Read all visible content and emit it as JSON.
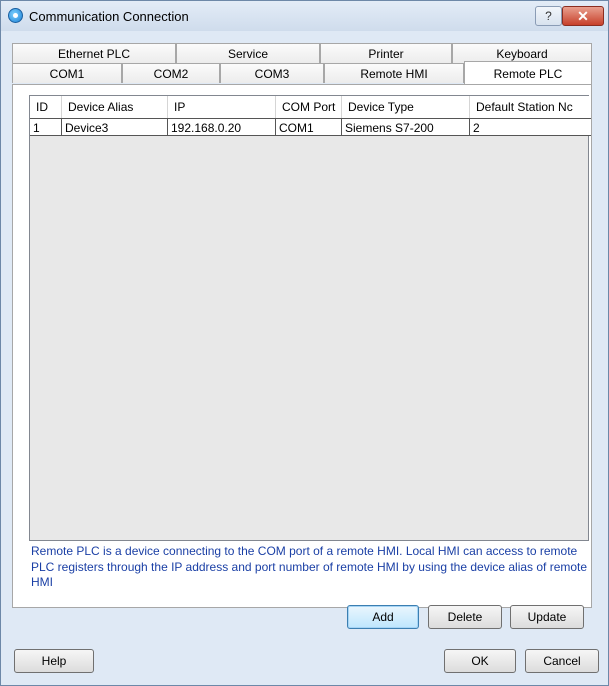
{
  "window": {
    "title": "Communication Connection",
    "help_glyph": "?",
    "close_glyph": "✕"
  },
  "tabs_top": [
    "Ethernet PLC",
    "Service",
    "Printer",
    "Keyboard"
  ],
  "tabs_bottom": [
    "COM1",
    "COM2",
    "COM3",
    "Remote HMI",
    "Remote PLC"
  ],
  "active_tab": "Remote PLC",
  "table": {
    "columns": [
      "ID",
      "Device Alias",
      "IP",
      "COM Port",
      "Device Type",
      "Default Station Nc"
    ],
    "rows": [
      [
        "1",
        "Device3",
        "192.168.0.20",
        "COM1",
        "Siemens S7-200",
        "2"
      ]
    ]
  },
  "note": "Remote PLC is a device connecting to the COM port of a remote HMI. Local HMI can access to remote PLC registers through the IP address and port number of remote HMI by using the device alias of remote HMI",
  "buttons": {
    "add": "Add",
    "delete": "Delete",
    "update": "Update",
    "help": "Help",
    "ok": "OK",
    "cancel": "Cancel"
  }
}
